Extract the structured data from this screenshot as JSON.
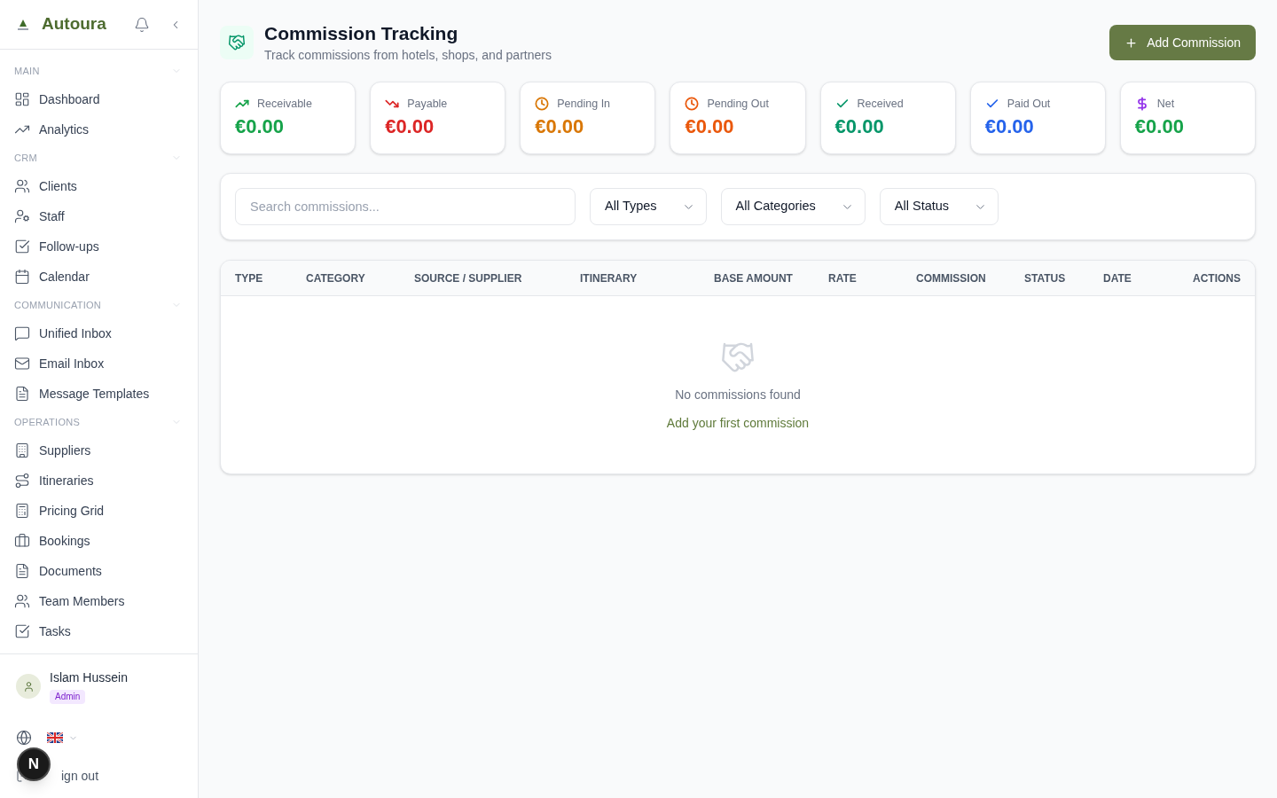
{
  "sidebar": {
    "brand": "Autoura",
    "sections": [
      {
        "title": "MAIN",
        "expanded": true,
        "items": [
          {
            "label": "Dashboard",
            "selected": false
          },
          {
            "label": "Analytics",
            "selected": false
          }
        ]
      },
      {
        "title": "CRM",
        "expanded": true,
        "items": [
          {
            "label": "Clients",
            "selected": false
          },
          {
            "label": "Staff",
            "selected": false
          },
          {
            "label": "Follow-ups",
            "selected": false
          },
          {
            "label": "Calendar",
            "selected": false
          }
        ]
      },
      {
        "title": "COMMUNICATION",
        "expanded": true,
        "items": [
          {
            "label": "Unified Inbox",
            "selected": false
          },
          {
            "label": "Email Inbox",
            "selected": false
          },
          {
            "label": "Message Templates",
            "selected": false
          }
        ]
      },
      {
        "title": "OPERATIONS",
        "expanded": true,
        "items": [
          {
            "label": "Suppliers",
            "selected": false
          },
          {
            "label": "Itineraries",
            "selected": false
          },
          {
            "label": "Pricing Grid",
            "selected": false
          },
          {
            "label": "Bookings",
            "selected": false
          },
          {
            "label": "Documents",
            "selected": false
          },
          {
            "label": "Team Members",
            "selected": false
          },
          {
            "label": "Tasks",
            "selected": false
          }
        ]
      }
    ],
    "user": {
      "name": "Islam Hussein",
      "role": "Admin"
    },
    "sign_out": "ign out"
  },
  "dev_badge": "N",
  "header": {
    "title": "Commission Tracking",
    "subtitle": "Track commissions from hotels, shops, and partners",
    "add_button": "Add Commission"
  },
  "stats": [
    {
      "kind": "rising",
      "label": "Receivable",
      "value": "€0.00",
      "color": "#16a34a",
      "icon": {
        "color": "#16a34a"
      }
    },
    {
      "kind": "falling",
      "label": "Payable",
      "value": "€0.00",
      "color": "#dc2626",
      "icon": {
        "color": "#dc2626"
      }
    },
    {
      "kind": "pending",
      "label": "Pending In",
      "value": "€0.00",
      "color": "#d97706",
      "icon": {
        "color": "#d97706"
      }
    },
    {
      "kind": "pending",
      "label": "Pending Out",
      "value": "€0.00",
      "color": "#ea580c",
      "icon": {
        "color": "#ea580c"
      }
    },
    {
      "kind": "settled",
      "label": "Received",
      "value": "€0.00",
      "color": "#059669",
      "icon": {
        "color": "#059669"
      }
    },
    {
      "kind": "settled",
      "label": "Paid Out",
      "value": "€0.00",
      "color": "#2563eb",
      "icon": {
        "color": "#2563eb"
      }
    },
    {
      "kind": "net",
      "label": "Net",
      "value": "€0.00",
      "color": "#16a34a",
      "icon": {
        "color": "#9333ea"
      }
    }
  ],
  "filters": {
    "search": {
      "placeholder": "Search commissions..."
    },
    "selects": [
      {
        "value": "All Types"
      },
      {
        "value": "All Categories"
      },
      {
        "value": "All Status"
      }
    ]
  },
  "table": {
    "columns": [
      "TYPE",
      "CATEGORY",
      "SOURCE / SUPPLIER",
      "ITINERARY",
      "BASE AMOUNT",
      "RATE",
      "COMMISSION",
      "STATUS",
      "DATE",
      "ACTIONS"
    ],
    "empty": {
      "message": "No commissions found",
      "action": "Add your first commission"
    }
  }
}
